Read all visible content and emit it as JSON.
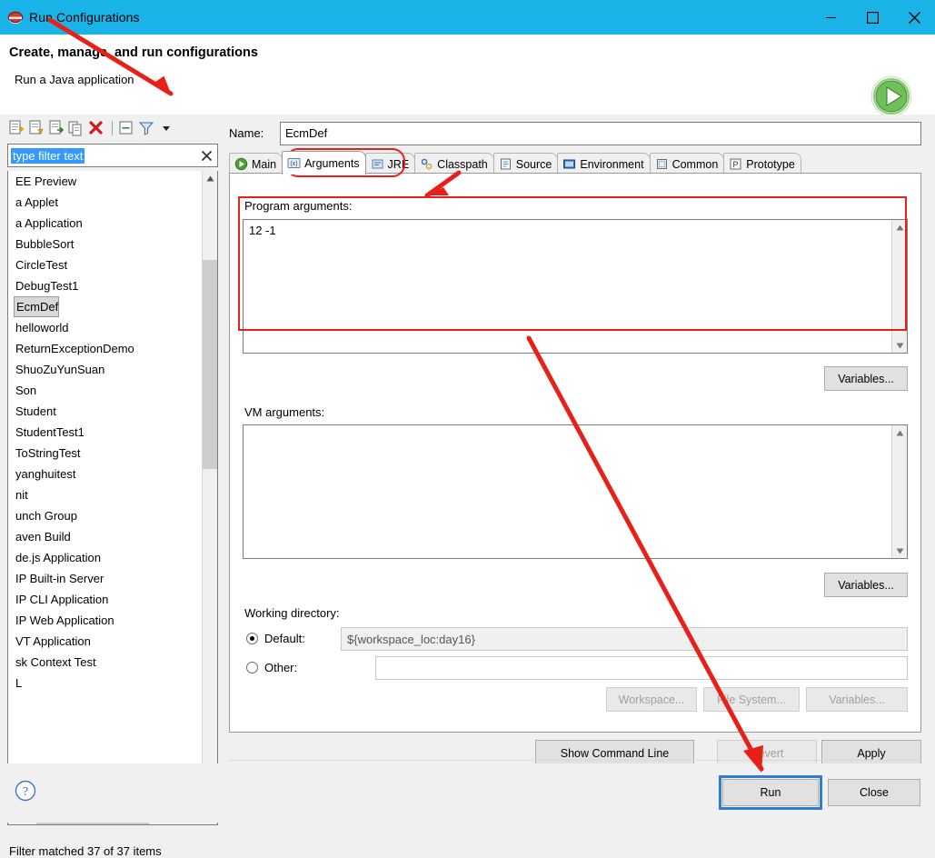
{
  "window": {
    "title": "Run Configurations",
    "app_icon": "eclipse-run-icon",
    "minimize_label": "Minimize",
    "maximize_label": "Maximize",
    "close_label": "Close"
  },
  "header": {
    "title": "Create, manage, and run configurations",
    "subtitle": "Run a Java application",
    "run_badge_icon": "run-play-icon"
  },
  "left": {
    "toolbar_icons": [
      "new-configuration-icon",
      "new-prototype-icon",
      "export-icon",
      "duplicate-icon",
      "delete-icon",
      "collapse-all-icon",
      "filter-icon",
      "view-menu-icon"
    ],
    "filter": {
      "value": "type filter text",
      "clear_icon": "clear-icon"
    },
    "items": [
      "EE Preview",
      "a Applet",
      "a Application",
      "BubbleSort",
      "CircleTest",
      "DebugTest1",
      "EcmDef",
      "helloworld",
      "ReturnExceptionDemo",
      "ShuoZuYunSuan",
      "Son",
      "Student",
      "StudentTest1",
      "ToStringTest",
      "yanghuitest",
      "nit",
      "unch Group",
      "aven Build",
      "de.js Application",
      "IP Built-in Server",
      "IP CLI Application",
      "IP Web Application",
      "VT Application",
      "sk Context Test",
      "L"
    ],
    "selected_item": "EcmDef",
    "status": "Filter matched 37 of 37 items"
  },
  "right": {
    "name_label": "Name:",
    "name_value": "EcmDef",
    "tabs": [
      {
        "label": "Main",
        "icon": "main-icon",
        "active": false
      },
      {
        "label": "Arguments",
        "icon": "arguments-icon",
        "active": true
      },
      {
        "label": "JRE",
        "icon": "jre-icon",
        "active": false
      },
      {
        "label": "Classpath",
        "icon": "classpath-icon",
        "active": false
      },
      {
        "label": "Source",
        "icon": "source-icon",
        "active": false
      },
      {
        "label": "Environment",
        "icon": "environment-icon",
        "active": false
      },
      {
        "label": "Common",
        "icon": "common-icon",
        "active": false
      },
      {
        "label": "Prototype",
        "icon": "prototype-icon",
        "active": false
      }
    ],
    "program_arguments": {
      "label": "Program arguments:",
      "value": "12 -1",
      "variables_button": "Variables..."
    },
    "vm_arguments": {
      "label": "VM arguments:",
      "value": "",
      "variables_button": "Variables..."
    },
    "working_directory": {
      "label": "Working directory:",
      "default_label": "Default:",
      "default_value": "${workspace_loc:day16}",
      "default_selected": true,
      "other_label": "Other:",
      "other_value": "",
      "workspace_button": "Workspace...",
      "filesystem_button": "File System...",
      "variables_button": "Variables..."
    },
    "show_command_line_button": "Show Command Line",
    "revert_button": "Revert",
    "apply_button": "Apply"
  },
  "footer": {
    "help_icon": "help-icon",
    "run_button": "Run",
    "close_button": "Close"
  },
  "annotations": {
    "accent_color": "#e8201a",
    "highlight_boxes": [
      "arguments-tab-highlight",
      "program-arguments-highlight",
      "run-button-highlight"
    ],
    "arrows": [
      "arrow-to-arguments-tab",
      "arrow-to-program-arguments",
      "arrow-to-run-button"
    ]
  },
  "colors": {
    "titlebar": "#1ab3e8",
    "selection_blue": "#3399ff",
    "annotation_red": "#e8201a",
    "run_green": "#3fae3f"
  }
}
